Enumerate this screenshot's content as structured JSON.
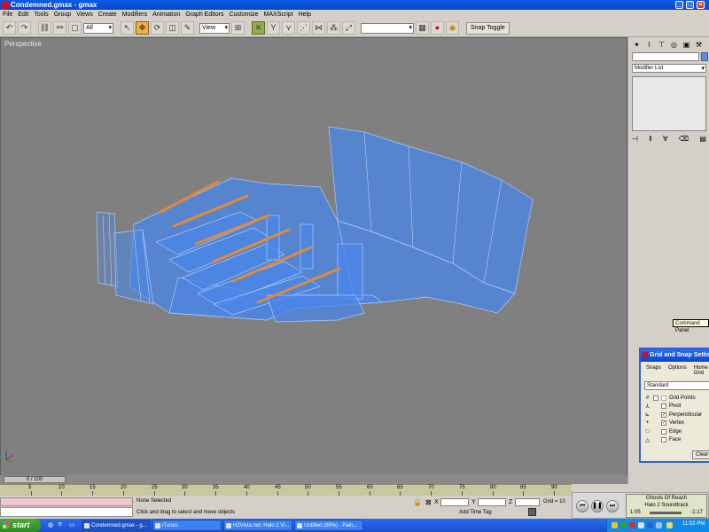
{
  "window": {
    "title": "Condemned.gmax - gmax",
    "min": "_",
    "max": "□",
    "close": "×"
  },
  "menu": [
    "File",
    "Edit",
    "Tools",
    "Group",
    "Views",
    "Create",
    "Modifiers",
    "Animation",
    "Graph Editors",
    "Customize",
    "MAXScript",
    "Help"
  ],
  "toolbar": {
    "selection_filter": "All",
    "ref_coord": "View",
    "named_sel": "",
    "snap_toggle": "Snap Toggle"
  },
  "viewport": {
    "label": "Perspective",
    "mesh_color": "#4a86e8",
    "rail_color": "#e08a3a"
  },
  "command_panel": {
    "modifier_list": "Modifier List",
    "tooltip": "Command Panel"
  },
  "snap_dialog": {
    "title": "Grid and Snap Settings",
    "tabs": [
      "Snaps",
      "Options",
      "Home Grid"
    ],
    "preset": "Standard",
    "items": [
      {
        "label": "Grid Points",
        "checked": false,
        "icon": "#"
      },
      {
        "label": "Pivot",
        "checked": false,
        "icon": "⅄"
      },
      {
        "label": "Perpendicular",
        "checked": true,
        "icon": "⊾"
      },
      {
        "label": "Vertex",
        "checked": true,
        "icon": "+"
      },
      {
        "label": "Edge",
        "checked": false,
        "icon": "□"
      },
      {
        "label": "Face",
        "checked": false,
        "icon": "△"
      }
    ],
    "clear_all": "Clear All"
  },
  "timeline": {
    "slider": "0 / 100",
    "ticks": [
      "5",
      "10",
      "15",
      "20",
      "25",
      "30",
      "35",
      "40",
      "45",
      "50",
      "55",
      "60",
      "65",
      "70",
      "75",
      "80",
      "85",
      "90"
    ]
  },
  "status": {
    "selection": "None Selected",
    "prompt": "Click and drag to select and move objects",
    "x_label": "X",
    "y_label": "Y",
    "z_label": "Z",
    "grid": "Grid = 10",
    "add_time_tag": "Add Time Tag"
  },
  "itunes": {
    "track": "Ghosts Of Reach",
    "album": "Halo 2 Soundtrack",
    "elapsed": "1:05",
    "remaining": "-1:17"
  },
  "taskbar": {
    "start": "start",
    "tasks": [
      {
        "label": "Condemned.gmax - g...",
        "active": true
      },
      {
        "label": "iTunes",
        "active": false
      },
      {
        "label": "H2Vista.net: Halo 2 Vi...",
        "active": false
      },
      {
        "label": "Untitled (86%) - Pain...",
        "active": false
      }
    ],
    "clock": "11:02 PM"
  }
}
